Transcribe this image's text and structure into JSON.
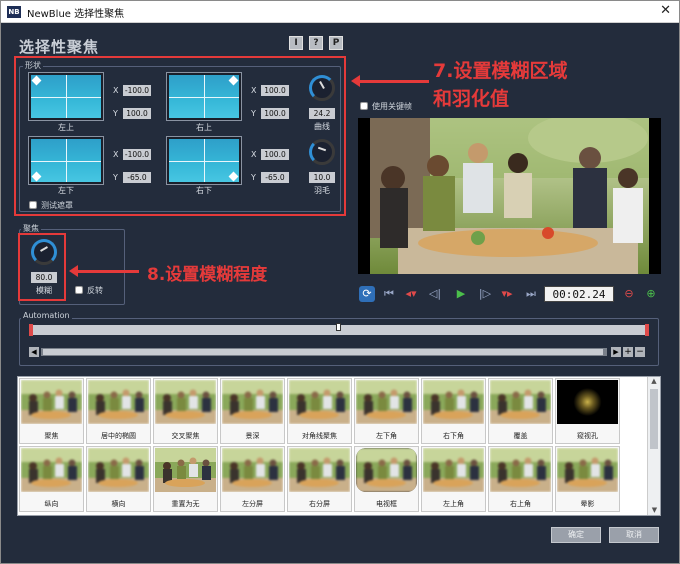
{
  "window": {
    "title": "NewBlue 选择性聚焦",
    "app_badge": "NB"
  },
  "heading": "选择性聚焦",
  "header_buttons": [
    "I",
    "?",
    "P"
  ],
  "shape_group": {
    "label": "形状",
    "quads": [
      {
        "label": "左上",
        "x": "-100.0",
        "y": "100.0"
      },
      {
        "label": "右上",
        "x": "100.0",
        "y": "100.0"
      },
      {
        "label": "左下",
        "x": "-100.0",
        "y": "-65.0"
      },
      {
        "label": "右下",
        "x": "100.0",
        "y": "-65.0"
      }
    ],
    "curve": {
      "value": "24.2",
      "label": "曲线"
    },
    "feather": {
      "value": "10.0",
      "label": "羽毛"
    },
    "test_mask_label": "测试遮罩",
    "test_mask_checked": false
  },
  "focus_group": {
    "label": "聚焦",
    "blur": {
      "value": "80.0",
      "label": "模糊"
    },
    "invert_label": "反转",
    "invert_checked": false
  },
  "use_keyframes_label": "使用关键帧",
  "annotations": {
    "step7_line1": "7.设置模糊区域",
    "step7_line2": "和羽化值",
    "step8": "8.设置模糊程度"
  },
  "transport": {
    "timecode": "00:02.24",
    "icons": [
      "loop-icon",
      "go-start-icon",
      "prev-keyframe-icon",
      "step-back-icon",
      "play-icon",
      "step-forward-icon",
      "next-keyframe-icon",
      "go-end-icon",
      "delete-keyframe-icon",
      "add-keyframe-icon"
    ]
  },
  "automation": {
    "label": "Automation"
  },
  "presets": {
    "row1": [
      "聚焦",
      "居中的椭圆",
      "交叉聚焦",
      "景深",
      "对角线聚焦",
      "左下角",
      "右下角",
      "覆盖",
      "窥视孔"
    ],
    "row2": [
      "纵向",
      "横向",
      "重置为无",
      "左分屏",
      "右分屏",
      "电视框",
      "左上角",
      "右上角",
      "晕影"
    ]
  },
  "footer": {
    "ok": "确定",
    "cancel": "取消"
  },
  "colors": {
    "accent_red": "#e53a3a",
    "background": "#232c3c",
    "quad_fill": "#36b8d8"
  }
}
